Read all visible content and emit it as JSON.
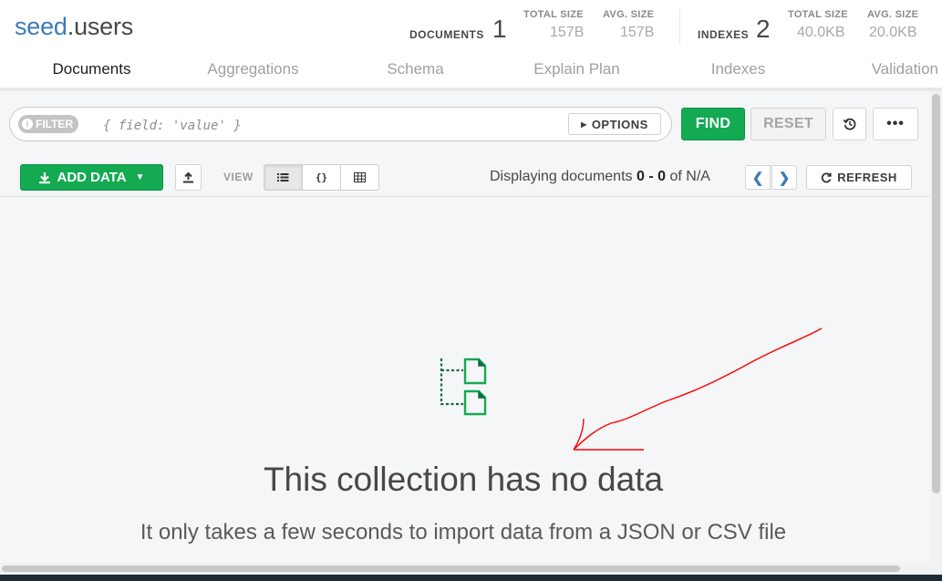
{
  "collection": {
    "database": "seed",
    "separator": ".",
    "name": "users"
  },
  "stats": {
    "documents_label": "Documents",
    "documents_count": "1",
    "total_size_label": "TOTAL SIZE",
    "total_size_value": "157B",
    "avg_size_label": "AVG. SIZE",
    "avg_size_value": "157B",
    "indexes_label": "Indexes",
    "indexes_count": "2",
    "index_total_size_label": "TOTAL SIZE",
    "index_total_size_value": "40.0KB",
    "index_avg_size_label": "AVG. SIZE",
    "index_avg_size_value": "20.0KB"
  },
  "tabs": [
    {
      "label": "Documents",
      "active": true
    },
    {
      "label": "Aggregations"
    },
    {
      "label": "Schema"
    },
    {
      "label": "Explain Plan"
    },
    {
      "label": "Indexes"
    },
    {
      "label": "Validation"
    }
  ],
  "query": {
    "filter_label": "FILTER",
    "filter_placeholder": "{ field: 'value' }",
    "options_label": "OPTIONS",
    "find_label": "FIND",
    "reset_label": "RESET",
    "more_label": "•••"
  },
  "toolbar": {
    "add_data_label": "ADD DATA",
    "view_label": "VIEW",
    "displaying_prefix": "Displaying documents",
    "range_start": "0",
    "range_sep": " - ",
    "range_end": "0",
    "of_label": "of",
    "total": "N/A",
    "refresh_label": "REFRESH"
  },
  "empty_state": {
    "title": "This collection has no data",
    "subtitle": "It only takes a few seconds to import data from a JSON or CSV file"
  },
  "colors": {
    "accent_green": "#13aa52",
    "link_blue": "#3d7ab8",
    "annotation_red": "#ff0000"
  },
  "icons": {
    "info": "info-icon",
    "caret": "caret-right-icon",
    "history": "history-icon",
    "download": "download-icon",
    "upload": "upload-icon",
    "list": "list-view-icon",
    "json": "json-view-icon",
    "table": "table-view-icon",
    "refresh": "refresh-icon"
  }
}
